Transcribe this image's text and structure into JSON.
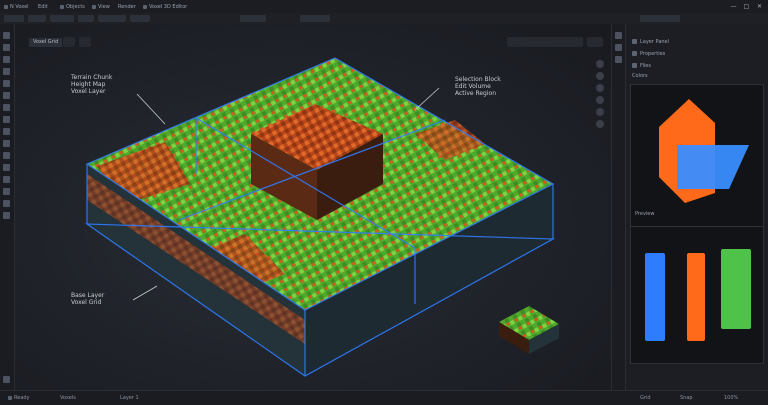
{
  "titlebar": {
    "items": [
      "N Voxel",
      "Edit",
      "Objects",
      "View",
      "Render",
      "Voxel 3D Editor"
    ],
    "window_controls": [
      "—",
      "□",
      "✕"
    ]
  },
  "viewport": {
    "tab_label": "Voxel Grid",
    "annotations": [
      "Terrain Chunk\nHeight Map\nVoxel Layer",
      "Selection Block\nEdit Volume\nActive Region",
      "Base Layer\nVoxel Grid"
    ]
  },
  "right_panel": {
    "rows": [
      "Layer Panel",
      "Properties",
      "Files"
    ],
    "section_label": "Colors",
    "preview_label": "Preview"
  },
  "colors": {
    "grid_line": "#2f7dff",
    "grass": "#5fbf32",
    "dirt": "#d55a1f",
    "orange_shape": "#ff6a1a",
    "blue_shape": "#3a8dff",
    "swatch_blue": "#2f7dff",
    "swatch_orange": "#ff6a1a",
    "swatch_green": "#4fc24a"
  },
  "statusbar": {
    "items": [
      "Ready",
      "Voxels",
      "Layer 1",
      "Grid",
      "Snap",
      "100%"
    ]
  }
}
